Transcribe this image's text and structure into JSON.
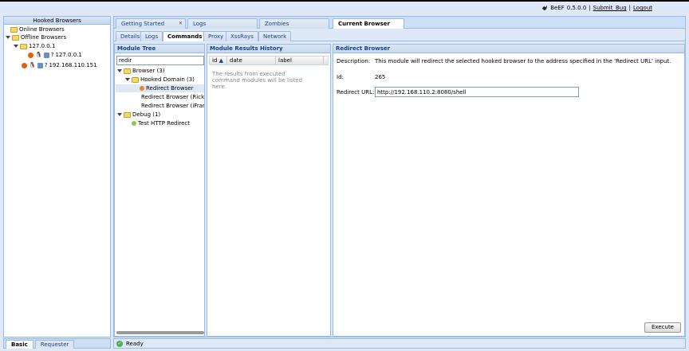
{
  "header": {
    "app_name": "BeEF",
    "version": "0.5.0.0",
    "separator": "|",
    "submit_bug": "Submit_Bug",
    "logout": "Logout"
  },
  "left_panel": {
    "title": "Hooked Browsers",
    "online_label": "Online Browsers",
    "offline_label": "Offline Browsers",
    "host_group": "127.0.0.1",
    "browsers": [
      {
        "ip": "127.0.0.1",
        "unknown": "?"
      },
      {
        "ip": "192.168.110.151",
        "unknown": "?"
      }
    ],
    "tabs": [
      "Basic",
      "Requester"
    ]
  },
  "main_tabs": [
    "Getting Started",
    "Logs",
    "Zombies",
    "Current Browser"
  ],
  "sub_tabs": [
    "Details",
    "Logs",
    "Commands",
    "Proxy",
    "XssRays",
    "Network"
  ],
  "module_tree": {
    "title": "Module Tree",
    "search_value": "redir",
    "items": [
      {
        "label": "Browser (3)"
      },
      {
        "label": "Hooked Domain (3)"
      },
      {
        "label": "Redirect Browser"
      },
      {
        "label": "Redirect Browser (Rickro"
      },
      {
        "label": "Redirect Browser (iFram"
      },
      {
        "label": "Debug (1)"
      },
      {
        "label": "Test HTTP Redirect"
      }
    ]
  },
  "results": {
    "title": "Module Results History",
    "columns": [
      "id",
      "date",
      "label"
    ],
    "sort_indicator": "▲",
    "empty_text": "The results from executed command modules will be listed here."
  },
  "redirect": {
    "title": "Redirect Browser",
    "description_label": "Description:",
    "description": "This module will redirect the selected hooked browser to the address specified in the 'Redirect URL' input.",
    "id_label": "Id:",
    "id_value": "265",
    "url_label": "Redirect URL:",
    "url_value": "http://192.168.110.2:8080/shell",
    "execute_label": "Execute"
  },
  "status": {
    "text": "Ready"
  },
  "colors": {
    "accent": "#15428b",
    "border": "#99bbe8",
    "background": "#dfe8f6"
  }
}
